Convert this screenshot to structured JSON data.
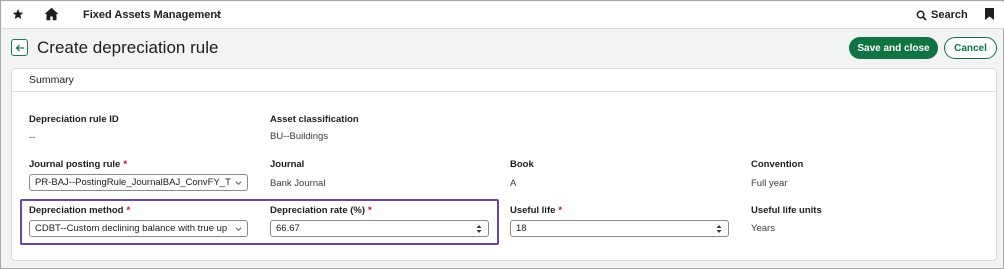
{
  "topbar": {
    "app_title": "Fixed Assets Management",
    "search_label": "Search"
  },
  "header": {
    "title": "Create depreciation rule",
    "save_close_label": "Save and close",
    "cancel_label": "Cancel"
  },
  "summary": {
    "section_title": "Summary",
    "rule_id": {
      "label": "Depreciation rule ID",
      "value": "--"
    },
    "asset_classification": {
      "label": "Asset classification",
      "value": "BU--Buildings"
    },
    "journal_posting_rule": {
      "label": "Journal posting rule",
      "value": "PR-BAJ--PostingRule_JournalBAJ_ConvFY_T"
    },
    "journal": {
      "label": "Journal",
      "value": "Bank Journal"
    },
    "book": {
      "label": "Book",
      "value": "A"
    },
    "convention": {
      "label": "Convention",
      "value": "Full year"
    },
    "depreciation_method": {
      "label": "Depreciation method",
      "value": "CDBT--Custom declining balance with true up"
    },
    "depreciation_rate": {
      "label": "Depreciation rate (%)",
      "value": "66.67"
    },
    "useful_life": {
      "label": "Useful life",
      "value": "18"
    },
    "useful_life_units": {
      "label": "Useful life units",
      "value": "Years"
    },
    "required_mark": "*"
  },
  "colors": {
    "primary": "#0f7343",
    "required": "#d0021b",
    "highlight": "#6a45a8"
  },
  "icons": [
    "star-icon",
    "home-icon",
    "chevron-down-icon",
    "search-icon",
    "bookmark-icon",
    "back-arrow-icon"
  ]
}
